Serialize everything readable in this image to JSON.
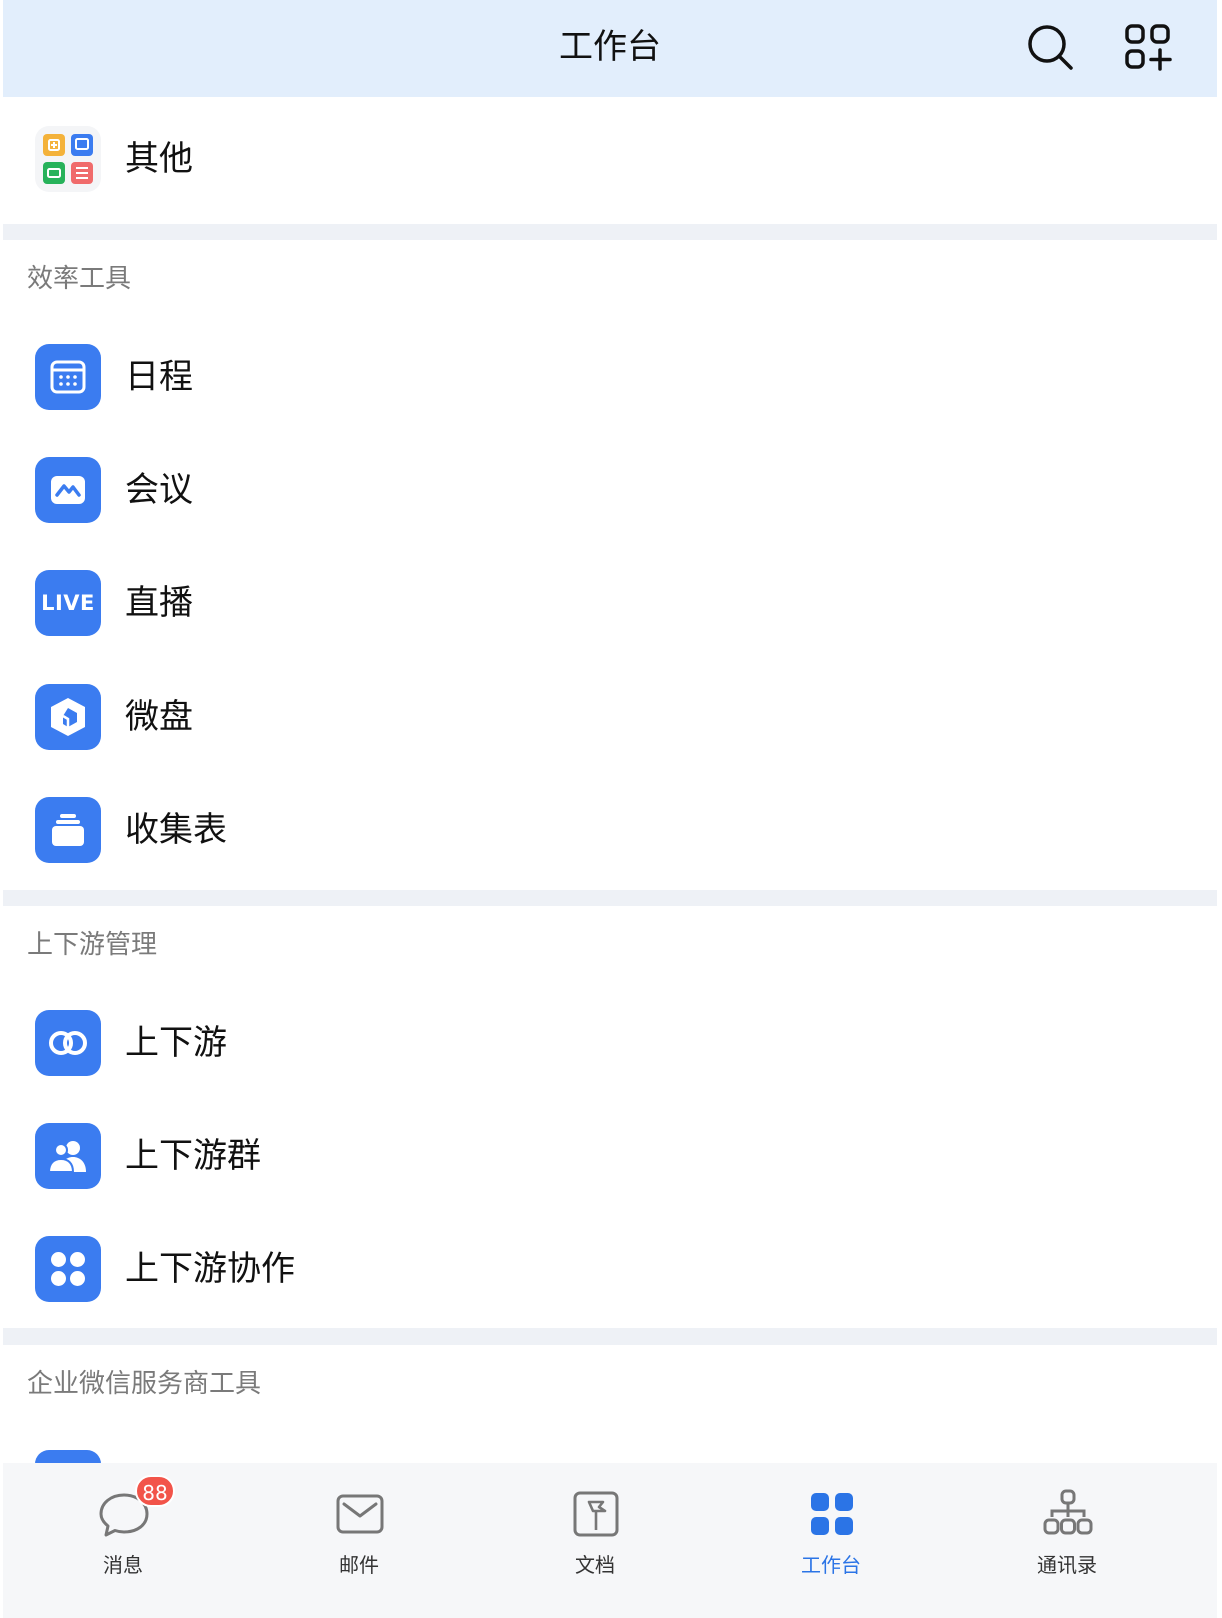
{
  "header": {
    "title": "工作台"
  },
  "top_item": {
    "label": "其他"
  },
  "sections": [
    {
      "title": "效率工具",
      "items": [
        {
          "label": "日程",
          "icon": "calendar-icon"
        },
        {
          "label": "会议",
          "icon": "meeting-icon"
        },
        {
          "label": "直播",
          "icon": "live-icon",
          "icon_text": "LIVE"
        },
        {
          "label": "微盘",
          "icon": "drive-icon"
        },
        {
          "label": "收集表",
          "icon": "form-collect-icon"
        }
      ]
    },
    {
      "title": "上下游管理",
      "items": [
        {
          "label": "上下游",
          "icon": "link-icon"
        },
        {
          "label": "上下游群",
          "icon": "group-icon"
        },
        {
          "label": "上下游协作",
          "icon": "collab-icon"
        }
      ]
    },
    {
      "title": "企业微信服务商工具",
      "items": []
    }
  ],
  "tabbar": {
    "tabs": [
      {
        "label": "消息",
        "icon": "chat-icon",
        "badge": "88"
      },
      {
        "label": "邮件",
        "icon": "mail-icon"
      },
      {
        "label": "文档",
        "icon": "doc-icon"
      },
      {
        "label": "工作台",
        "icon": "workbench-icon",
        "active": true
      },
      {
        "label": "通讯录",
        "icon": "contacts-icon"
      }
    ]
  },
  "colors": {
    "accent": "#2b74e6",
    "app_icon_bg": "#3b7cf0",
    "badge": "#f2544a",
    "header_bg": "#e2eefc"
  }
}
